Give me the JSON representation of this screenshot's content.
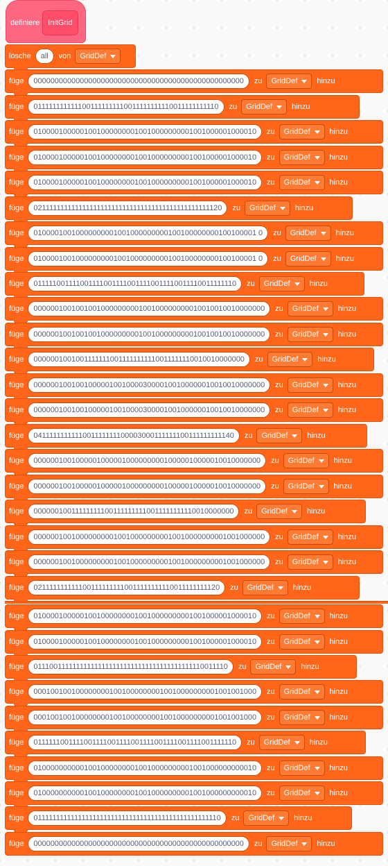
{
  "define_block": {
    "label": "definiere",
    "proc_name": "InitGrid",
    "color": "#ff6680"
  },
  "delete_block": {
    "label": "lösche",
    "value": "all",
    "from_label": "von",
    "list": "GridDef"
  },
  "add_block": {
    "label": "füge",
    "to_label": "zu",
    "suffix": "hinzu",
    "list": "GridDef",
    "color": "#ff661a"
  },
  "rows": [
    "00000000000000000000000000000000000000000000000000",
    "0111111111111001111111110011111111110011111111110",
    "01000010000010010000000010010000000001001000001000010",
    "01000010000010010000000010010000000001001000001000010",
    "01000010000010010000000010010000000001001000001000010",
    "021111111111111111111111111111111111111111111111120",
    "01000010010000000001001000000000100100000000100100001 0",
    "01000010010000000001001000000000100100000000100100001 0",
    "0111110011110011110011110011110011110011110011111110",
    "0000001001001001000000000100100000000010010010010000000",
    "0000001001001001000000000100100000000010010010010000000",
    "00000010010011111110011111111110011111110010010000000",
    "0000001001001000001001000030000100100000010010010000000",
    "0000001001001000001001000030000100100000010010010000000",
    "0411111111111001111111100003000111111100111111111140",
    "000000100100000100000100000000010000010000010010000000",
    "000000100100000100000100000000010000010000010010000000",
    "000000100111111111001111111110011111111110010000000",
    "0000001001000000000100100000000010010000000001001000000",
    "0000001001000000000100100000000010010000000001001000000",
    "0211111111111001111111110011111111110011111111120",
    "01000010000010010000000010010000000001001000001000010",
    "01000010000010010000000010010000000001001000001000010",
    "0111001111111111111111111111111111111111111110011110",
    "00010010010000000010010000000010010000000001001001000",
    "00010010010000000010010000000010010000000001001001000",
    "0111111001111001111001111001111001111001111001111110",
    "01000000000010010000000010010000000001001000000000010",
    "01000000000010010000000010010000000001001000000000010",
    "011111111111111111111111111111111111111111111111110",
    "00000000000000000000000000000000000000000000000000"
  ]
}
